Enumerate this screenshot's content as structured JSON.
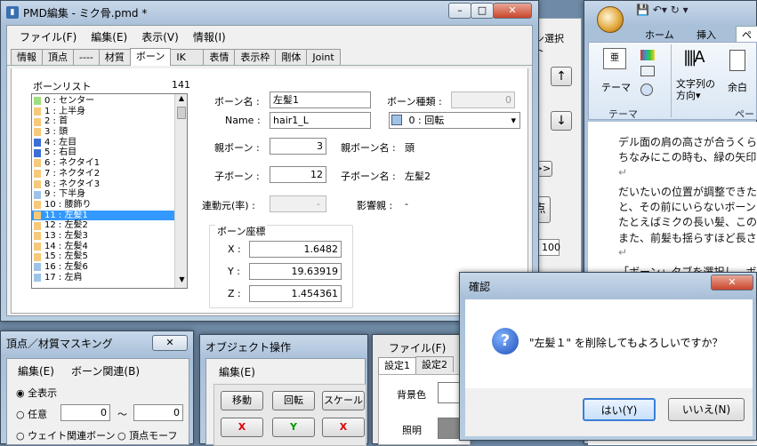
{
  "main_window": {
    "title": "PMD編集 - ミク骨.pmd *",
    "menu": [
      "ファイル(F)",
      "編集(E)",
      "表示(V)",
      "情報(I)"
    ],
    "tabs": [
      "情報",
      "頂点",
      "----",
      "材質",
      "ボーン",
      "IK",
      "表情",
      "表示枠",
      "剛体",
      "Joint"
    ],
    "active_tab": "ボーン",
    "bone_list": {
      "label": "ボーンリスト",
      "count": "141",
      "items": [
        {
          "text": "0 : センター",
          "color": "#9fdf7f"
        },
        {
          "text": "1 : 上半身",
          "color": "#f7c97a"
        },
        {
          "text": "2 : 首",
          "color": "#f7c97a"
        },
        {
          "text": "3 : 頭",
          "color": "#f7c97a"
        },
        {
          "text": "4 : 左目",
          "color": "#3b6fd6"
        },
        {
          "text": "5 : 右目",
          "color": "#3b6fd6"
        },
        {
          "text": "6 : ネクタイ1",
          "color": "#f7c97a"
        },
        {
          "text": "7 : ネクタイ2",
          "color": "#f7c97a"
        },
        {
          "text": "8 : ネクタイ3",
          "color": "#f7c97a"
        },
        {
          "text": "9 : 下半身",
          "color": "#9ec3e8"
        },
        {
          "text": "10 : 腰飾り",
          "color": "#f7c97a"
        },
        {
          "text": "11 : 左髪1",
          "color": "#f7c97a"
        },
        {
          "text": "12 : 左髪2",
          "color": "#f7c97a"
        },
        {
          "text": "13 : 左髪3",
          "color": "#f7c97a"
        },
        {
          "text": "14 : 左髪4",
          "color": "#f7c97a"
        },
        {
          "text": "15 : 左髪5",
          "color": "#f7c97a"
        },
        {
          "text": "16 : 左髪6",
          "color": "#9ec3e8"
        },
        {
          "text": "17 : 左肩",
          "color": "#9ec3e8"
        }
      ],
      "selected_index": 11
    },
    "fields": {
      "bone_name_label": "ボーン名 :",
      "bone_name": "左髪1",
      "name_label": "Name :",
      "name_en": "hair1_L",
      "bone_type_label": "ボーン種類 :",
      "bone_type_num": "0",
      "type_select": "0 : 回転",
      "parent_label": "親ボーン :",
      "parent_value": "3",
      "parent_name_label": "親ボーン名 :",
      "parent_name": "頭",
      "child_label": "子ボーン :",
      "child_value": "12",
      "child_name_label": "子ボーン名 :",
      "child_name": "左髪2",
      "link_label": "連動元(率) :",
      "link_value": "-",
      "influence_label": "影響親 :",
      "influence_value": "-",
      "coords_title": "ボーン座標",
      "x_label": "X :",
      "x_value": "1.6482",
      "y_label": "Y :",
      "y_value": "19.63919",
      "z_label": "Z :",
      "z_value": "1.454361"
    }
  },
  "vertex_mask": {
    "title": "頂点／材質マスキング",
    "menu": [
      "編集(E)",
      "ボーン関連(B)"
    ],
    "radio_all": "全表示",
    "radio_any": "任意",
    "any_from": "0",
    "tilde": "～",
    "any_to": "0",
    "radio_weight": "ウェイト関連ボーン",
    "radio_vertex_morph": "頂点モーフ"
  },
  "object_ops": {
    "title": "オブジェクト操作",
    "menu": "編集(E)",
    "buttons": [
      "移動",
      "回転",
      "スケール"
    ],
    "axes": [
      "X",
      "Y",
      "X"
    ]
  },
  "settings_panel": {
    "menu": "ファイル(F)",
    "tabs": [
      "設定1",
      "設定2"
    ],
    "bg_label": "背景色",
    "light_label": "照明"
  },
  "middle_panel": {
    "label1": "ン選択",
    "label2": "ト",
    "up_arrow": "↑",
    "down_arrow": "↓",
    "fwd": ">>",
    "pt": "点",
    "val": "100"
  },
  "word": {
    "tabs": [
      "ホーム",
      "挿入",
      "ペ"
    ],
    "groups": {
      "theme": "テーマ",
      "theme_btn": "テーマ",
      "text_dir": "文字列の\n方向▾",
      "margin": "余白",
      "page": "ペー"
    },
    "lines": [
      "デル面の肩の高さが合うくら",
      "ちなみにこの時も、緑の矢印",
      "↵",
      "だいたいの位置が調整できた",
      "と、その前にいらないボーン",
      "たとえばミクの長い髪、この",
      "また、前髪も揺らすほど長さ",
      "↵",
      "「ボーン」タブを選択し、ボ"
    ]
  },
  "dialog": {
    "title": "確認",
    "icon": "question-icon",
    "message": "\"左髪１\" を削除してもよろしいですか？",
    "yes": "はい(Y)",
    "no": "いいえ(N)"
  }
}
